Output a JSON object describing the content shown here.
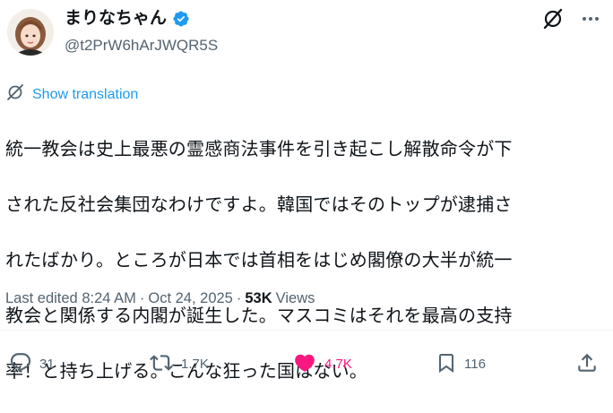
{
  "author": {
    "display_name": "まりなちゃん",
    "handle": "@t2PrW6hArJWQR5S",
    "verified": true
  },
  "translate_label": "Show translation",
  "tweet_lines": [
    "統一教会は史上最悪の霊感商法事件を引き起こし解散命令が下",
    "された反社会集団なわけですよ。韓国ではそのトップが逮捕さ",
    "れたばかり。ところが日本では首相をはじめ閣僚の大半が統一",
    "教会と関係する内閣が誕生した。マスコミはそれを最高の支持",
    "率！と持ち上げる。こんな狂った国はない。"
  ],
  "meta": {
    "edited_prefix": "Last edited",
    "time": "8:24 AM",
    "separator": "·",
    "date": "Oct 24, 2025",
    "views_count": "53K",
    "views_label": "Views"
  },
  "actions": {
    "replies": "31",
    "reposts": "1.7K",
    "likes": "4.7K",
    "bookmarks": "116"
  },
  "colors": {
    "accent": "#1d9bf0",
    "like": "#f91880",
    "muted": "#536471",
    "text": "#0f1419"
  }
}
